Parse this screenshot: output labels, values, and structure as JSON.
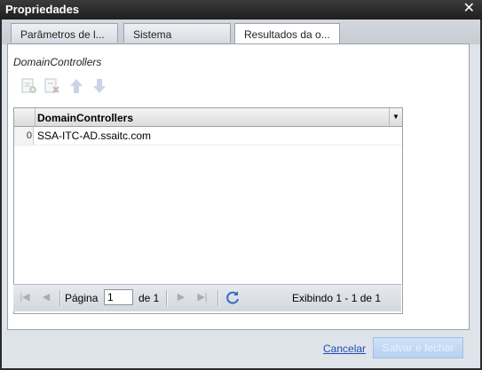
{
  "window": {
    "title": "Propriedades"
  },
  "tabs": [
    {
      "label": "Parâmetros de l..."
    },
    {
      "label": "Sistema"
    },
    {
      "label": "Resultados da o..."
    }
  ],
  "section": {
    "label": "DomainControllers"
  },
  "grid": {
    "column": "DomainControllers",
    "rows": [
      {
        "index": "0",
        "value": "SSA-ITC-AD.ssaitc.com"
      }
    ]
  },
  "pager": {
    "page_label": "Página",
    "page_value": "1",
    "of_label": "de 1",
    "display": "Exibindo 1 - 1 de 1"
  },
  "footer": {
    "cancel": "Cancelar",
    "save": "Salvar e fechar"
  }
}
